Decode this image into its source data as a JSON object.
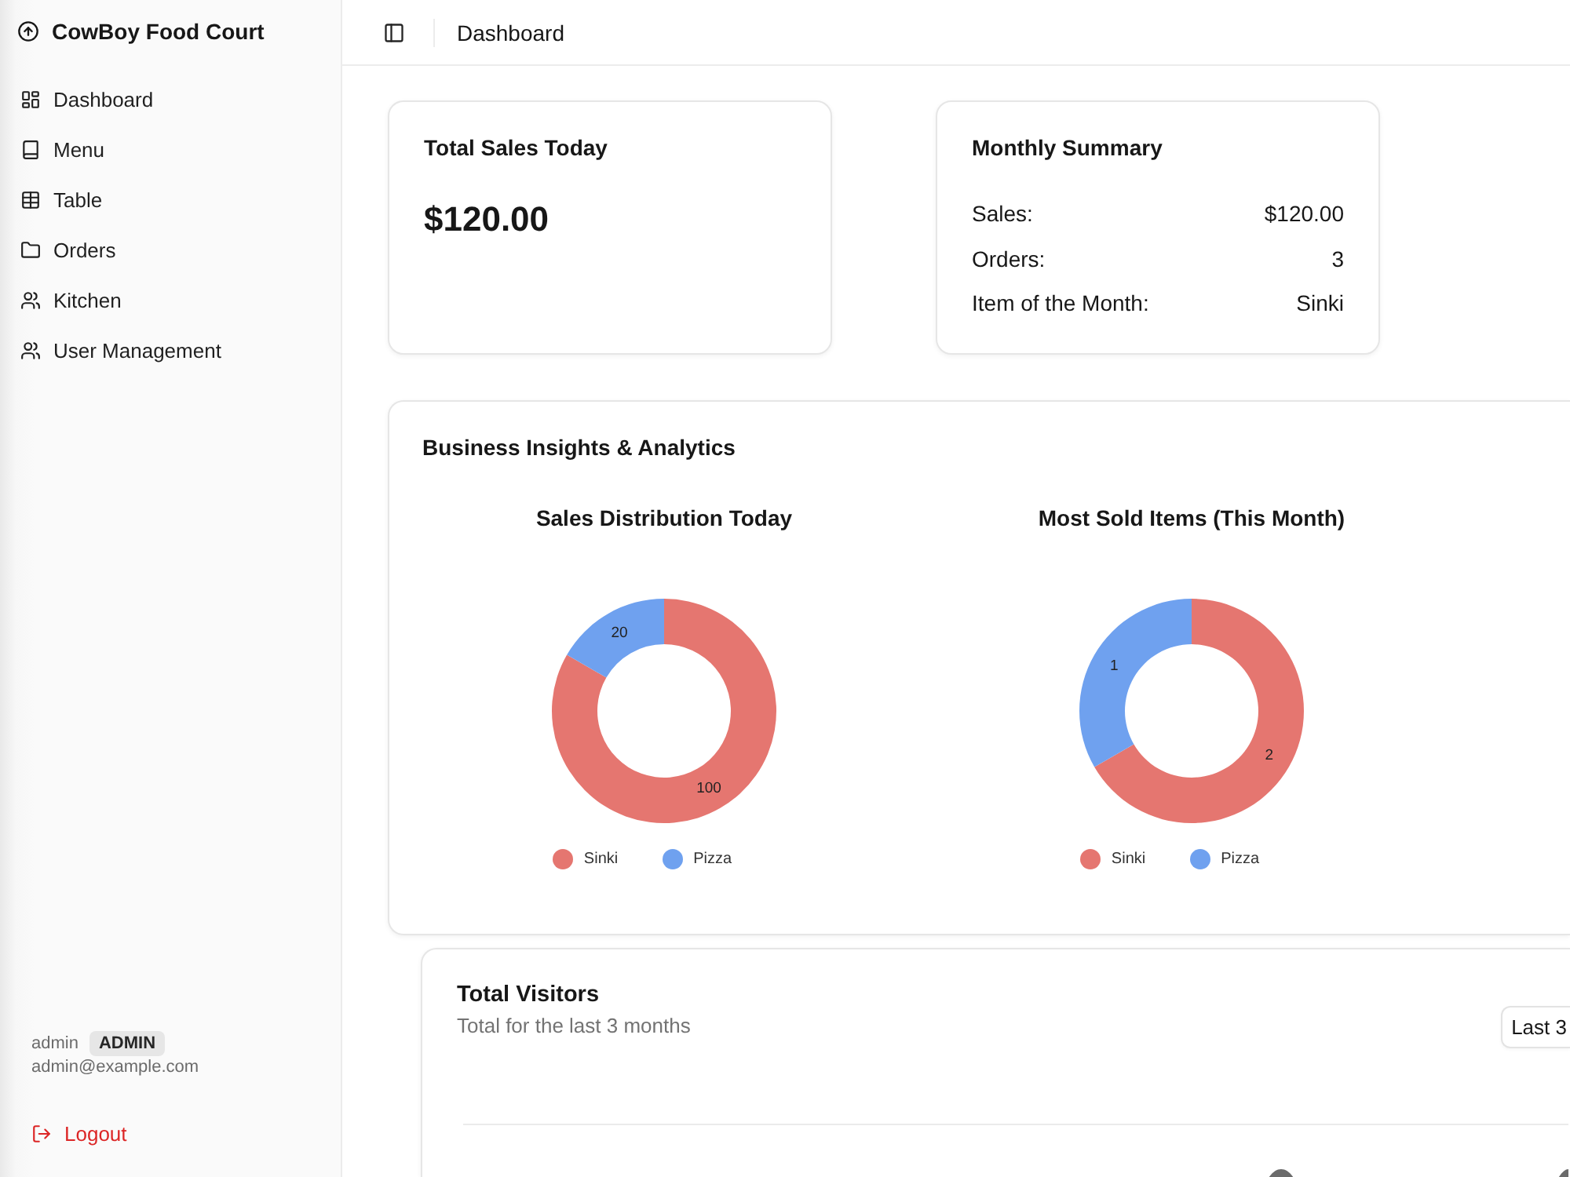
{
  "sidebar": {
    "brand": "CowBoy Food Court",
    "items": [
      {
        "label": "Dashboard",
        "selected": false
      },
      {
        "label": "Menu",
        "selected": false
      },
      {
        "label": "Table",
        "selected": false
      },
      {
        "label": "Orders",
        "selected": false
      },
      {
        "label": "Kitchen",
        "selected": false
      },
      {
        "label": "User Management",
        "selected": false
      }
    ],
    "user": {
      "name": "admin",
      "role": "ADMIN",
      "email": "admin@example.com"
    },
    "logout": "Logout"
  },
  "header": {
    "title": "Dashboard"
  },
  "total_sales": {
    "title": "Total Sales Today",
    "value": "$120.00"
  },
  "monthly_summary": {
    "title": "Monthly Summary",
    "rows": [
      {
        "label": "Sales:",
        "value": "$120.00"
      },
      {
        "label": "Orders:",
        "value": "3"
      },
      {
        "label": "Item of the Month:",
        "value": "Sinki"
      }
    ]
  },
  "insights": {
    "title": "Business Insights & Analytics",
    "chart_data": [
      {
        "type": "donut",
        "title": "Sales Distribution Today",
        "categories": [
          "Sinki",
          "Pizza"
        ],
        "values": [
          100,
          20
        ],
        "colors": [
          "#e57670",
          "#6fa1ef"
        ],
        "data_labels": true,
        "legend": "bottom"
      },
      {
        "type": "donut",
        "title": "Most Sold Items (This Month)",
        "categories": [
          "Sinki",
          "Pizza"
        ],
        "values": [
          2,
          1
        ],
        "colors": [
          "#e57670",
          "#6fa1ef"
        ],
        "data_labels": true,
        "legend": "bottom"
      }
    ]
  },
  "visitors": {
    "title": "Total Visitors",
    "subtitle": "Total for the last 3 months",
    "range_select": "Last 3"
  }
}
